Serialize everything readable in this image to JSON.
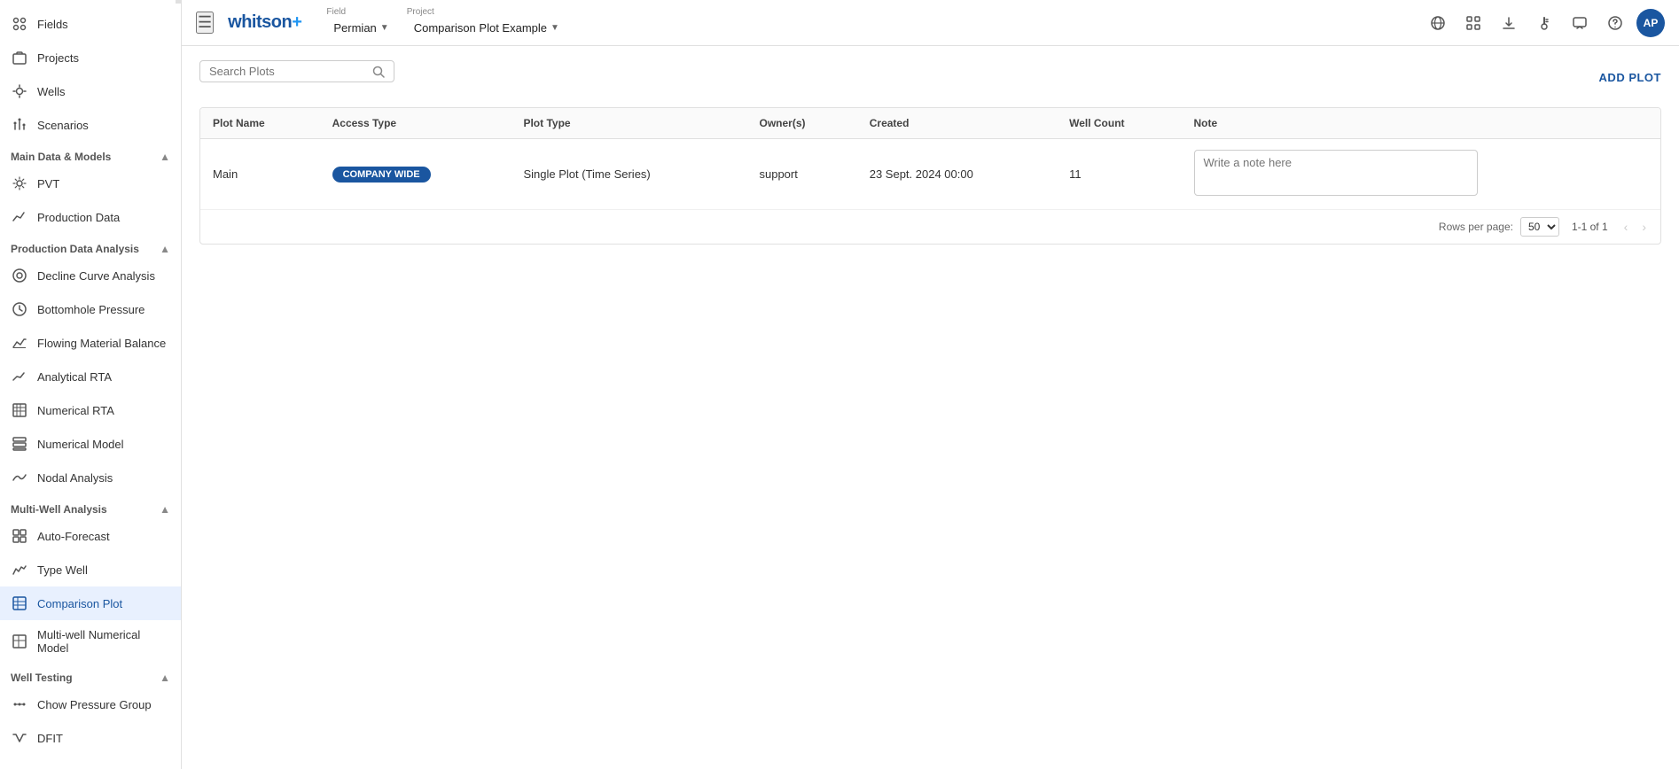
{
  "sidebar": {
    "top_items": [
      {
        "id": "fields",
        "label": "Fields",
        "icon": "grid"
      },
      {
        "id": "projects",
        "label": "Projects",
        "icon": "folder"
      },
      {
        "id": "wells",
        "label": "Wells",
        "icon": "circle-dot"
      },
      {
        "id": "scenarios",
        "label": "Scenarios",
        "icon": "branch"
      }
    ],
    "sections": [
      {
        "id": "main-data-models",
        "label": "Main Data & Models",
        "expanded": true,
        "items": [
          {
            "id": "pvt",
            "label": "PVT",
            "icon": "molecule"
          },
          {
            "id": "production-data",
            "label": "Production Data",
            "icon": "trend"
          }
        ]
      },
      {
        "id": "production-data-analysis",
        "label": "Production Data Analysis",
        "expanded": true,
        "items": [
          {
            "id": "decline-curve-analysis",
            "label": "Decline Curve Analysis",
            "icon": "gear-circle"
          },
          {
            "id": "bottomhole-pressure",
            "label": "Bottomhole Pressure",
            "icon": "gauge"
          },
          {
            "id": "flowing-material-balance",
            "label": "Flowing Material Balance",
            "icon": "line-chart"
          },
          {
            "id": "analytical-rta",
            "label": "Analytical RTA",
            "icon": "trend-up"
          },
          {
            "id": "numerical-rta",
            "label": "Numerical RTA",
            "icon": "grid-line"
          },
          {
            "id": "numerical-model",
            "label": "Numerical Model",
            "icon": "table"
          },
          {
            "id": "nodal-analysis",
            "label": "Nodal Analysis",
            "icon": "wave"
          }
        ]
      },
      {
        "id": "multi-well-analysis",
        "label": "Multi-Well Analysis",
        "expanded": true,
        "items": [
          {
            "id": "auto-forecast",
            "label": "Auto-Forecast",
            "icon": "grid4"
          },
          {
            "id": "type-well",
            "label": "Type Well",
            "icon": "area-chart"
          },
          {
            "id": "comparison-plot",
            "label": "Comparison Plot",
            "icon": "comparison",
            "active": true
          },
          {
            "id": "multi-well-numerical-model",
            "label": "Multi-well Numerical Model",
            "icon": "table2"
          }
        ]
      },
      {
        "id": "well-testing",
        "label": "Well Testing",
        "expanded": true,
        "items": [
          {
            "id": "chow-pressure-group",
            "label": "Chow Pressure Group",
            "icon": "dots-line"
          },
          {
            "id": "dfit",
            "label": "DFIT",
            "icon": "area-down"
          }
        ]
      }
    ]
  },
  "topbar": {
    "menu_icon": "☰",
    "logo": "whitson",
    "logo_plus": "+",
    "field_label": "Field",
    "field_value": "Permian",
    "project_label": "Project",
    "project_value": "Comparison Plot Example",
    "icons": [
      "globe",
      "grid",
      "download",
      "temperature",
      "message",
      "help"
    ],
    "avatar": "AP"
  },
  "content": {
    "search_placeholder": "Search Plots",
    "add_plot_label": "ADD PLOT",
    "table": {
      "columns": [
        {
          "id": "plot-name",
          "label": "Plot Name"
        },
        {
          "id": "access-type",
          "label": "Access Type"
        },
        {
          "id": "plot-type",
          "label": "Plot Type"
        },
        {
          "id": "owner",
          "label": "Owner(s)"
        },
        {
          "id": "created",
          "label": "Created"
        },
        {
          "id": "well-count",
          "label": "Well Count"
        },
        {
          "id": "note",
          "label": "Note"
        }
      ],
      "rows": [
        {
          "plot_name": "Main",
          "access_type": "COMPANY WIDE",
          "plot_type": "Single Plot (Time Series)",
          "owner": "support",
          "created": "23 Sept. 2024 00:00",
          "well_count": "11",
          "note_placeholder": "Write a note here"
        }
      ]
    },
    "pagination": {
      "rows_per_page_label": "Rows per page:",
      "rows_per_page_value": "50",
      "rows_info": "1-1 of 1",
      "prev_disabled": true,
      "next_disabled": true
    }
  }
}
